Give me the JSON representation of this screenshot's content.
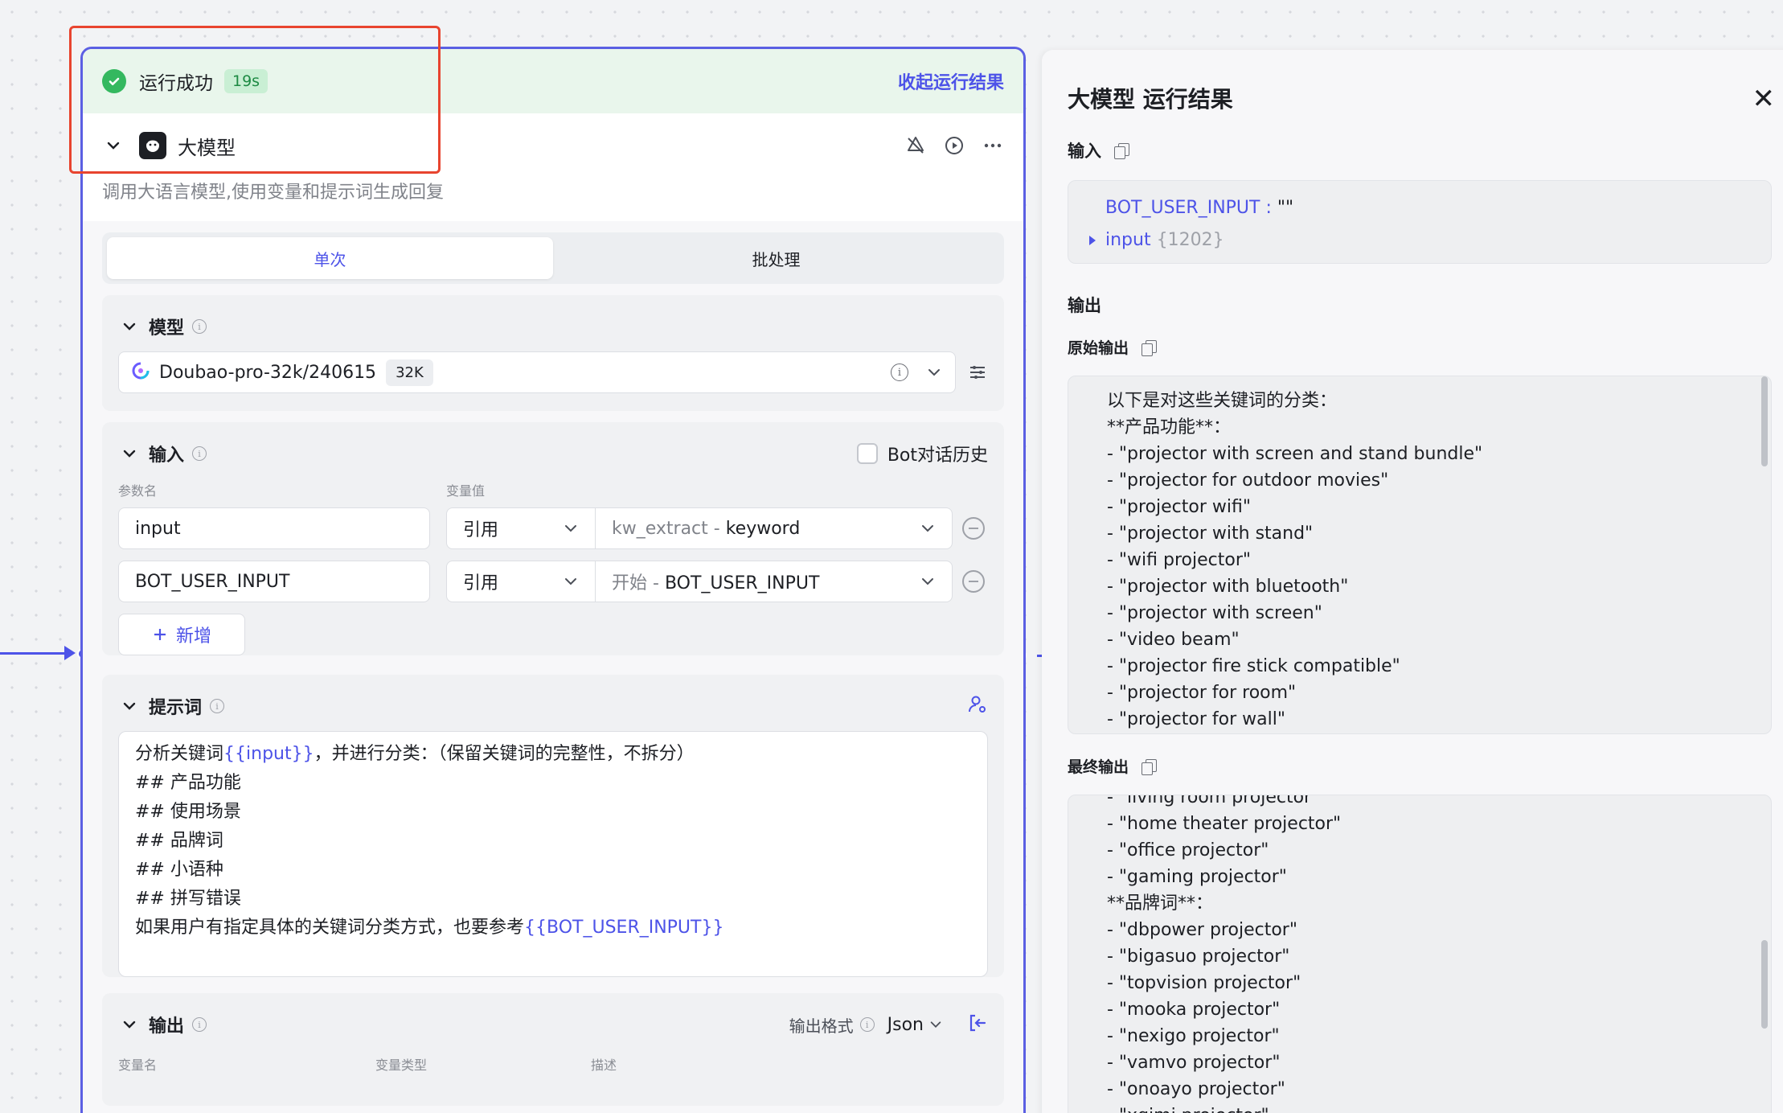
{
  "run_bar": {
    "status": "运行成功",
    "time": "19s",
    "collapse": "收起运行结果"
  },
  "node": {
    "title": "大模型",
    "description": "调用大语言模型,使用变量和提示词生成回复",
    "tabs": [
      "单次",
      "批处理"
    ],
    "model_section": {
      "title": "模型",
      "model_name": "Doubao-pro-32k/240615",
      "context": "32K"
    },
    "input_section": {
      "title": "输入",
      "bot_history": "Bot对话历史",
      "col_param": "参数名",
      "col_value": "变量值",
      "rows": [
        {
          "name": "input",
          "ref": "引用",
          "source": "kw_extract",
          "sep": " - ",
          "value": "keyword"
        },
        {
          "name": "BOT_USER_INPUT",
          "ref": "引用",
          "source": "开始",
          "sep": " - ",
          "value": "BOT_USER_INPUT"
        }
      ],
      "add": "新增"
    },
    "prompt_section": {
      "title": "提示词",
      "line1_a": "分析关键词",
      "line1_var": "{{input}}",
      "line1_b": "，并进行分类：（保留关键词的完整性，不拆分）",
      "lines": [
        "## 产品功能",
        "## 使用场景",
        "## 品牌词",
        "## 小语种",
        "## 拼写错误"
      ],
      "last_a": "如果用户有指定具体的关键词分类方式，也要参考",
      "last_var": "{{BOT_USER_INPUT}}"
    },
    "output_section": {
      "title": "输出",
      "format_label": "输出格式",
      "format_value": "Json",
      "cols": [
        "变量名",
        "变量类型",
        "描述"
      ]
    }
  },
  "panel": {
    "title": "大模型 运行结果",
    "input_label": "输入",
    "input_json": {
      "key1": "BOT_USER_INPUT",
      "val1": "\"\"",
      "key2": "input",
      "val2": "{1202}"
    },
    "output_label": "输出",
    "raw_label": "原始输出",
    "raw_lines": [
      "以下是对这些关键词的分类：",
      "**产品功能**：",
      "- \"projector with screen and stand bundle\"",
      "- \"projector for outdoor movies\"",
      "- \"projector wifi\"",
      "- \"projector with stand\"",
      "- \"wifi projector\"",
      "- \"projector with bluetooth\"",
      "- \"projector with screen\"",
      "- \"video beam\"",
      "- \"projector fire stick compatible\"",
      "- \"projector for room\"",
      "- \"projector for wall\""
    ],
    "final_label": "最终输出",
    "final_lines": [
      "- \"living room projector\"",
      "- \"home theater projector\"",
      "- \"office projector\"",
      "- \"gaming projector\"",
      "**品牌词**：",
      "- \"dbpower projector\"",
      "- \"bigasuo projector\"",
      "- \"topvision projector\"",
      "- \"mooka projector\"",
      "- \"nexigo projector\"",
      "- \"vamvo projector\"",
      "- \"onoayo projector\"",
      "- \"xgimi projector\""
    ]
  },
  "colors": {
    "accent": "#4d53e8",
    "success": "#34b85f",
    "highlight": "#e8442f"
  }
}
